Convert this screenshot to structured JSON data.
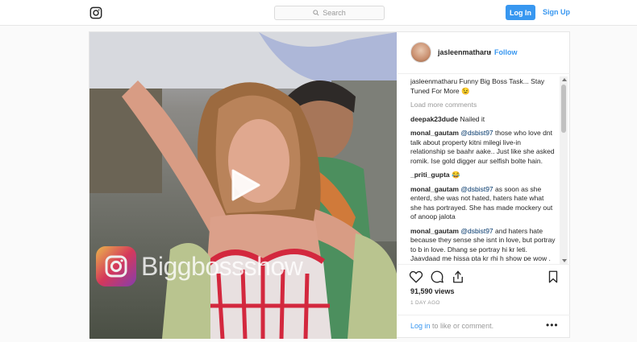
{
  "topbar": {
    "logo_icon": "instagram-glyph-icon",
    "search_placeholder": "Search",
    "login_label": "Log In",
    "signup_label": "Sign Up",
    "accent": "#3897f0"
  },
  "post": {
    "username": "jasleenmatharu",
    "separator": "•",
    "follow_label": "Follow",
    "caption_user": "jasleenmatharu",
    "caption_text": "Funny Big Boss Task... Stay Tuned For More 😉",
    "load_more": "Load more comments",
    "comments": [
      {
        "user": "deepak23dude",
        "mention": "",
        "text": "Nailed it"
      },
      {
        "user": "monal_gautam",
        "mention": "@dsbist97",
        "text": "those who love dnt talk about property kitni milegi live-in relationship se baahr aake.. Just like she asked romik. Ise gold digger aur selfish bolte hain."
      },
      {
        "user": "_priti_gupta",
        "mention": "",
        "text": "😂"
      },
      {
        "user": "monal_gautam",
        "mention": "@dsbist97",
        "text": "as soon as she enterd, she was not hated, haters hate what she has portrayed. She has made mockery out of anoop jalota"
      },
      {
        "user": "monal_gautam",
        "mention": "@dsbist97",
        "text": "and haters hate because they sense she isnt in love, but portray to b in love. Dhang se portray hi kr leti. Jaaydaad me hissa pta kr rhi h show pe wow . What love"
      }
    ],
    "views": "91,590 views",
    "posted_ago": "1 DAY AGO",
    "bottom_login": "Log in",
    "bottom_rest": "to like or comment.",
    "more_label": "•••"
  },
  "media": {
    "watermark_text": "Biggbossshow",
    "play_icon": "play-icon"
  }
}
